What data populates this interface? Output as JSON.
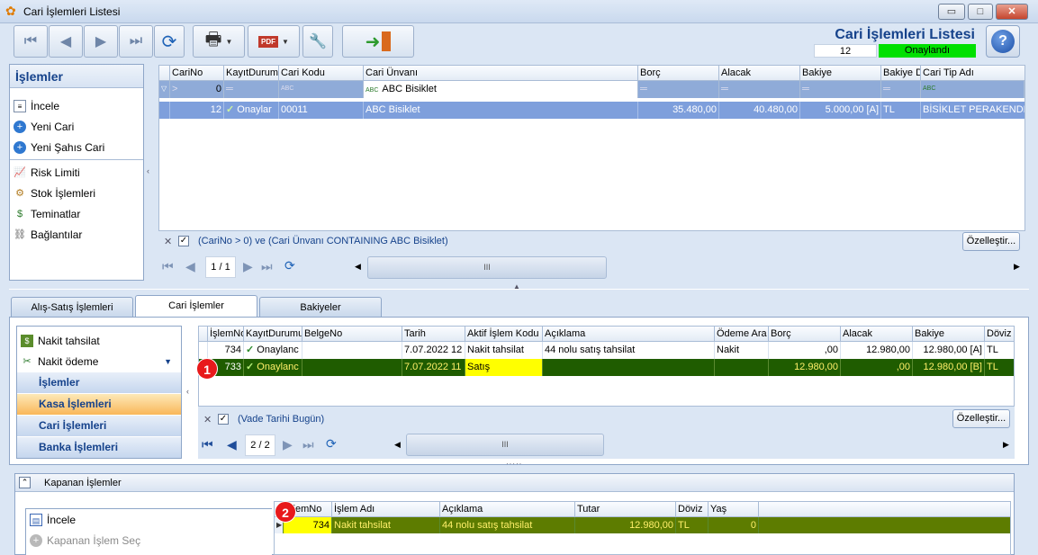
{
  "window": {
    "title": "Cari İşlemleri Listesi",
    "minimize": "▭",
    "maximize": "□",
    "close": "✕"
  },
  "header": {
    "title": "Cari İşlemleri Listesi",
    "count": "12",
    "status": "Onaylandı",
    "help": "?"
  },
  "toolbar": {
    "first": "⏮",
    "prev": "◀",
    "next": "▶",
    "last": "⏭",
    "refresh": "⟳",
    "print": "🖶",
    "pdf": "PDF",
    "settings": "🔧",
    "exit": "➜"
  },
  "left_panel": {
    "title": "İşlemler",
    "items": [
      {
        "label": "İncele",
        "icon": "document-icon"
      },
      {
        "label": "Yeni Cari",
        "icon": "add-icon"
      },
      {
        "label": "Yeni Şahıs Cari",
        "icon": "add-icon"
      },
      {
        "label": "Risk Limiti",
        "icon": "chart-icon"
      },
      {
        "label": "Stok İşlemleri",
        "icon": "box-icon"
      },
      {
        "label": "Teminatlar",
        "icon": "money-icon"
      },
      {
        "label": "Bağlantılar",
        "icon": "link-icon"
      }
    ]
  },
  "top_grid": {
    "columns": [
      "CariNo",
      "KayıtDurumu",
      "Cari Kodu",
      "Cari Ünvanı",
      "Borç",
      "Alacak",
      "Bakiye",
      "Bakiye D",
      "Cari Tip Adı"
    ],
    "filter": {
      "carino": "0",
      "eq": "═",
      "abc": "ABC",
      "unvan": "ABC Bisiklet"
    },
    "rows": [
      {
        "carino": "12",
        "durum": "Onaylar",
        "kod": "00011",
        "unvan": "ABC Bisiklet",
        "borc": "35.480,00",
        "alacak": "40.480,00",
        "bakiye": "5.000,00 [A]",
        "doviz": "TL",
        "tip": "BİSİKLET PERAKENDECİ"
      }
    ],
    "filter_text": "(CariNo > 0) ve (Cari Ünvanı CONTAINING ABC Bisiklet)",
    "customize": "Özelleştir...",
    "page": "1 / 1",
    "scroll": "III"
  },
  "tabs": [
    "Alış-Satış İşlemleri",
    "Cari İşlemler",
    "Bakiyeler"
  ],
  "bottom_left": {
    "items": [
      {
        "label": "Nakit tahsilat"
      },
      {
        "label": "Nakit ödeme"
      }
    ],
    "nav": [
      "İşlemler",
      "Kasa İşlemleri",
      "Cari İşlemleri",
      "Banka İşlemleri"
    ]
  },
  "mid_grid": {
    "columns": [
      "İşlemNo",
      "KayıtDurumu",
      "BelgeNo",
      "Tarih",
      "Aktif İşlem Kodu",
      "Açıklama",
      "Ödeme Ara",
      "Borç",
      "Alacak",
      "Bakiye",
      "Döviz"
    ],
    "rows": [
      {
        "no": "734",
        "durum": "Onaylanc",
        "belge": "",
        "tarih": "7.07.2022 12",
        "kod": "Nakit tahsilat",
        "aciklama": "44 nolu satış tahsilat",
        "odeme": "Nakit",
        "borc": ",00",
        "alacak": "12.980,00",
        "bakiye": "12.980,00 [A]",
        "doviz": "TL"
      },
      {
        "no": "733",
        "durum": "Onaylanc",
        "belge": "",
        "tarih": "7.07.2022 11",
        "kod": "Satış",
        "aciklama": "",
        "odeme": "",
        "borc": "12.980,00",
        "alacak": ",00",
        "bakiye": "12.980,00 [B]",
        "doviz": "TL"
      }
    ],
    "filter_text": "(Vade Tarihi Bugün)",
    "customize": "Özelleştir...",
    "page": "2 / 2",
    "scroll": "III"
  },
  "closed_section": {
    "title": "Kapanan İşlemler",
    "items": [
      {
        "label": "İncele"
      },
      {
        "label": "Kapanan İşlem Seç"
      }
    ],
    "columns": [
      "İşlemNo",
      "İşlem Adı",
      "Açıklama",
      "Tutar",
      "Döviz",
      "Yaş"
    ],
    "rows": [
      {
        "no": "734",
        "adi": "Nakit tahsilat",
        "aciklama": "44 nolu satış tahsilat",
        "tutar": "12.980,00",
        "doviz": "TL",
        "yas": "0"
      }
    ]
  },
  "badges": [
    "1",
    "2"
  ],
  "colors": {
    "accent": "#15428b",
    "approved": "#00e000",
    "highlight": "#ffff00",
    "row_dark": "#1f5c00",
    "badge": "#e8191b"
  }
}
